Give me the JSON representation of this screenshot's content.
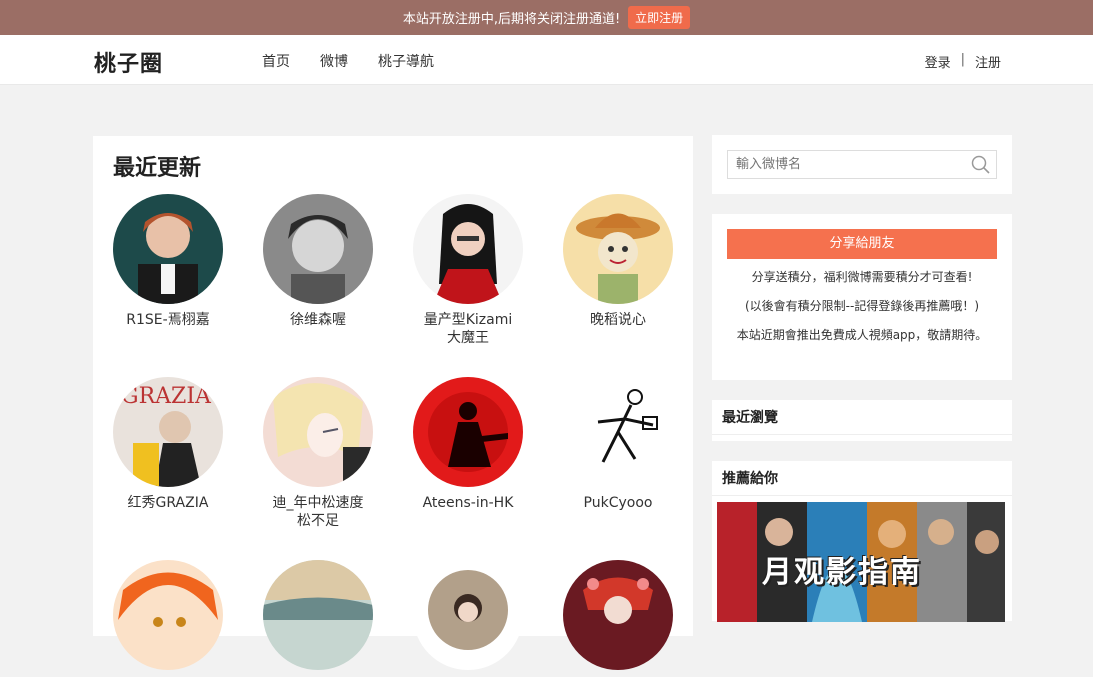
{
  "announcement": {
    "message": "本站开放注册中,后期将关闭注册通道!",
    "button": "立即注册"
  },
  "header": {
    "logo": "桃子圈",
    "nav": [
      "首页",
      "微博",
      "桃子導航"
    ],
    "login": "登录",
    "separator": "|",
    "register": "注册"
  },
  "main": {
    "title": "最近更新",
    "cards": [
      {
        "name": "R1SE-焉栩嘉",
        "icon": "avatar-person"
      },
      {
        "name": "徐维森喔",
        "icon": "avatar-person"
      },
      {
        "name": "量产型Kizami大魔王",
        "icon": "avatar-person"
      },
      {
        "name": "晚稻说心",
        "icon": "avatar-scarecrow"
      },
      {
        "name": "红秀GRAZIA",
        "icon": "avatar-magazine"
      },
      {
        "name": "迪_年中松速度松不足",
        "icon": "avatar-anime"
      },
      {
        "name": "Ateens-in-HK",
        "icon": "avatar-silhouette"
      },
      {
        "name": "PukCyooo",
        "icon": "avatar-sketch"
      },
      {
        "name": "",
        "icon": "avatar-anime"
      },
      {
        "name": "",
        "icon": "avatar-landscape"
      },
      {
        "name": "",
        "icon": "avatar-person"
      },
      {
        "name": "",
        "icon": "avatar-person"
      }
    ]
  },
  "sidebar": {
    "search_placeholder": "輸入微博名",
    "share_button": "分享給朋友",
    "share_line1": "分享送積分，福利微博需要積分才可查看!",
    "share_line2": "(以後會有積分限制--記得登錄後再推薦哦！)",
    "share_line3": "本站近期會推出免費成人視頻app，敬請期待。",
    "recent_title": "最近瀏覽",
    "recommend_title": "推薦給你",
    "recommend_banner_text": "月观影指南"
  },
  "colors": {
    "topbar": "#9b6e65",
    "accent": "#f5714e",
    "page_bg": "#f2f2f2"
  }
}
